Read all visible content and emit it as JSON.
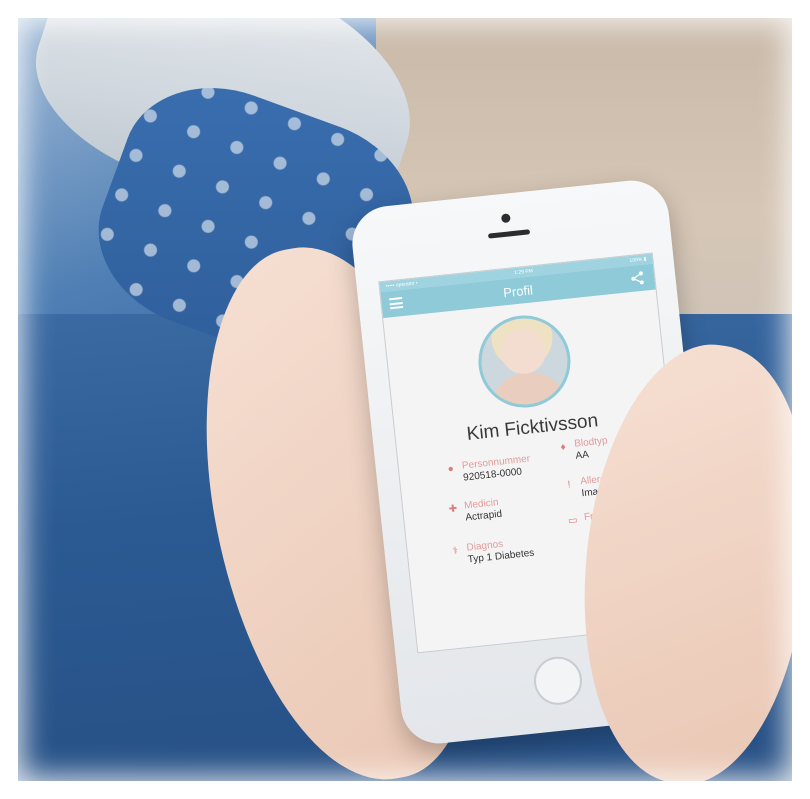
{
  "app": {
    "title": "Profil",
    "status_left": "••••• operator •",
    "status_center": "1:29 PM",
    "status_right": "100% ▮"
  },
  "profile": {
    "name": "Kim Ficktivsson",
    "fields": [
      {
        "label": "Personnummer",
        "value": "920518-0000",
        "icon": "person-icon"
      },
      {
        "label": "Blodtyp",
        "value": "AA",
        "icon": "blood-drop-icon"
      },
      {
        "label": "Medicin",
        "value": "Actrapid",
        "icon": "medkit-icon"
      },
      {
        "label": "Allergier",
        "value": "Imacillin",
        "icon": "exclamation-icon"
      },
      {
        "label": "Diagnos",
        "value": "Typ 1 Diabetes",
        "icon": "stethoscope-icon"
      },
      {
        "label": "Frikort",
        "value": "",
        "icon": "card-icon"
      }
    ]
  },
  "colors": {
    "appbar": "#8fcad8",
    "label": "#e39a9a",
    "icon": "#e07b7b"
  }
}
